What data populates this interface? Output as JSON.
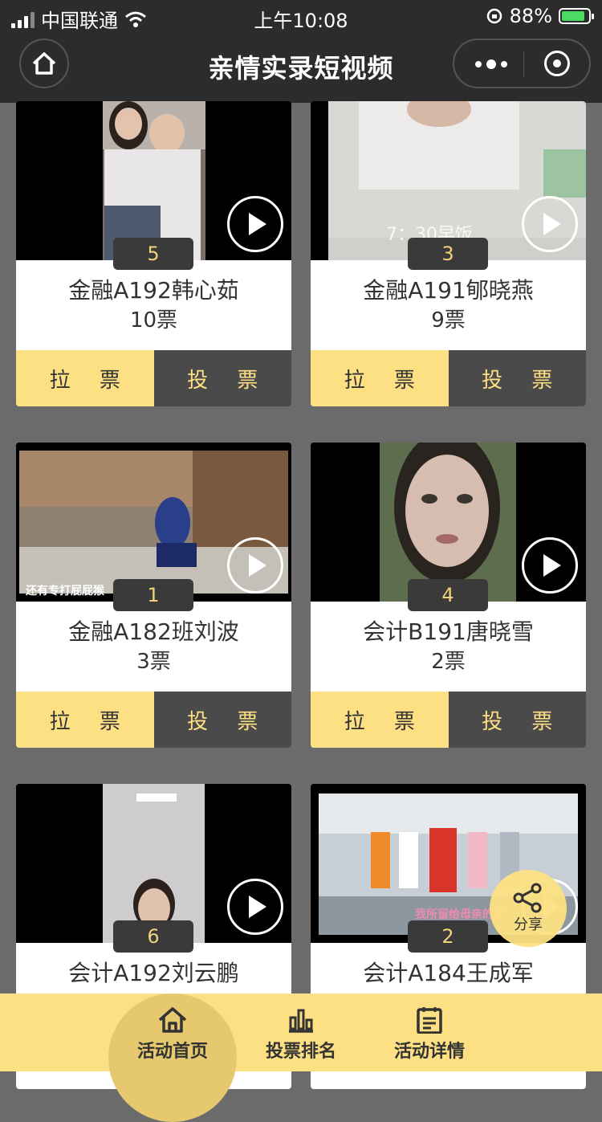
{
  "status_bar": {
    "carrier": "中国联通",
    "time": "上午10:08",
    "battery": "88%",
    "battery_level": 0.88
  },
  "nav": {
    "title": "亲情实录短视频"
  },
  "colors": {
    "accent": "#fde083",
    "dark": "#4a4a4a",
    "bar": "#2c2c2c"
  },
  "cards": [
    {
      "rank": "5",
      "name": "金融A192韩心茹",
      "votes": "10票",
      "rally_label": "拉 票",
      "vote_label": "投 票"
    },
    {
      "rank": "3",
      "name": "金融A191郇晓燕",
      "votes": "9票",
      "rally_label": "拉 票",
      "vote_label": "投 票",
      "overlay": "7：30早饭"
    },
    {
      "rank": "1",
      "name": "金融A182班刘波",
      "votes": "3票",
      "rally_label": "拉 票",
      "vote_label": "投 票",
      "caption": "还有专打屁屁猴"
    },
    {
      "rank": "4",
      "name": "会计B191唐晓雪",
      "votes": "2票",
      "rally_label": "拉 票",
      "vote_label": "投 票"
    },
    {
      "rank": "6",
      "name": "会计A192刘云鹏"
    },
    {
      "rank": "2",
      "name": "会计A184王成军",
      "caption": "我所留给母亲的是"
    }
  ],
  "share": {
    "label": "分享"
  },
  "tabs": [
    {
      "label": "活动首页",
      "icon": "home-icon",
      "active": true
    },
    {
      "label": "投票排名",
      "icon": "bar-chart-icon"
    },
    {
      "label": "活动详情",
      "icon": "document-icon"
    }
  ]
}
